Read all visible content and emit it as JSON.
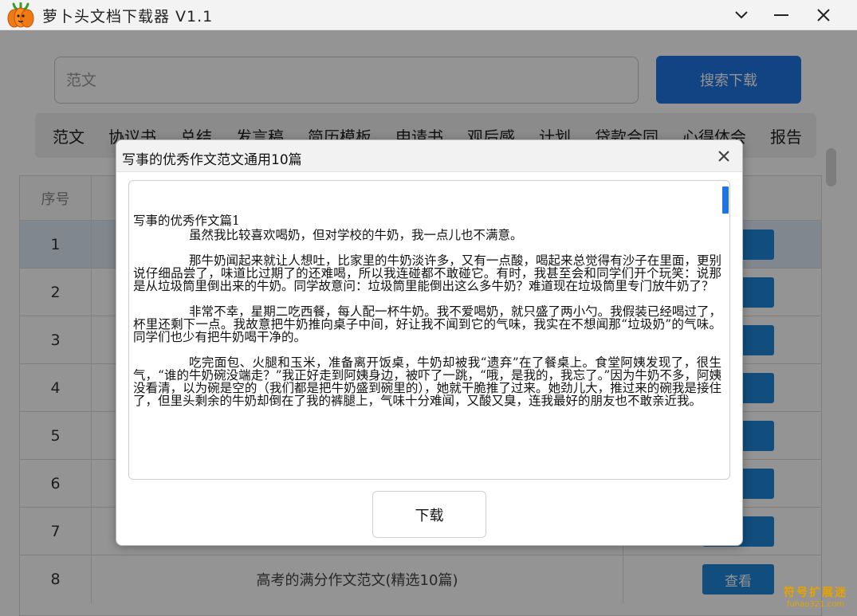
{
  "window": {
    "title": "萝卜头文档下载器 V1.1",
    "controls": {
      "collapse": "∨",
      "minimize": "—",
      "close": "✕"
    }
  },
  "search": {
    "placeholder": "范文",
    "button_label": "搜索下载"
  },
  "categories": [
    "范文",
    "协议书",
    "总结",
    "发言稿",
    "简历模板",
    "申请书",
    "观后感",
    "计划",
    "贷款合同",
    "心得体会",
    "报告"
  ],
  "table": {
    "header": {
      "num": "序号"
    },
    "rows": [
      {
        "num": "1",
        "title": "",
        "action": ""
      },
      {
        "num": "2",
        "title": "",
        "action": ""
      },
      {
        "num": "3",
        "title": "",
        "action": ""
      },
      {
        "num": "4",
        "title": "",
        "action": ""
      },
      {
        "num": "5",
        "title": "",
        "action": ""
      },
      {
        "num": "6",
        "title": "",
        "action": ""
      },
      {
        "num": "7",
        "title": "",
        "action": ""
      },
      {
        "num": "8",
        "title": "高考的满分作文范文(精选10篇)",
        "action": "查看"
      }
    ]
  },
  "dialog": {
    "title": "写事的优秀作文范文通用10篇",
    "close": "✕",
    "heading": "写事的优秀作文篇1",
    "paragraphs": [
      "虽然我比较喜欢喝奶，但对学校的牛奶，我一点儿也不满意。",
      "那牛奶闻起来就让人想吐，比家里的牛奶淡许多，又有一点酸，喝起来总觉得有沙子在里面，更别说仔细品尝了，味道比过期了的还难喝，所以我连碰都不敢碰它。有时，我甚至会和同学们开个玩笑：说那是从垃圾筒里倒出来的牛奶。同学故意问：垃圾筒里能倒出这么多牛奶？难道现在垃圾筒里专门放牛奶了？",
      "非常不幸，星期二吃西餐，每人配一杯牛奶。我不爱喝奶，就只盛了两小勺。我假装已经喝过了，杯里还剩下一点。我故意把牛奶推向桌子中间，好让我不闻到它的气味，我实在不想闻那“垃圾奶”的气味。同学们也少有把牛奶喝干净的。",
      "吃完面包、火腿和玉米，准备离开饭桌，牛奶却被我“遗弃”在了餐桌上。食堂阿姨发现了，很生气，“谁的牛奶碗没端走？”我正好走到阿姨身边，被吓了一跳，“哦，是我的，我忘了。”因为牛奶不多，阿姨没看清，以为碗是空的（我们都是把牛奶盛到碗里的），她就干脆推了过来。她劲儿大，推过来的碗我是接住了，但里头剩余的牛奶却倒在了我的裤腿上，气味十分难闻，又酸又臭，连我最好的朋友也不敢亲近我。"
    ],
    "download_label": "下载"
  },
  "watermark": {
    "main": "符号扩展迷",
    "sub": "fuhao321.com"
  },
  "colors": {
    "accent": "#1f74e0",
    "view_button": "#1e86d8",
    "watermark": "#e8a200"
  },
  "icons": {
    "app": "carrot-icon",
    "collapse": "chevron-down-icon",
    "minimize": "minimize-icon",
    "close": "close-icon"
  }
}
